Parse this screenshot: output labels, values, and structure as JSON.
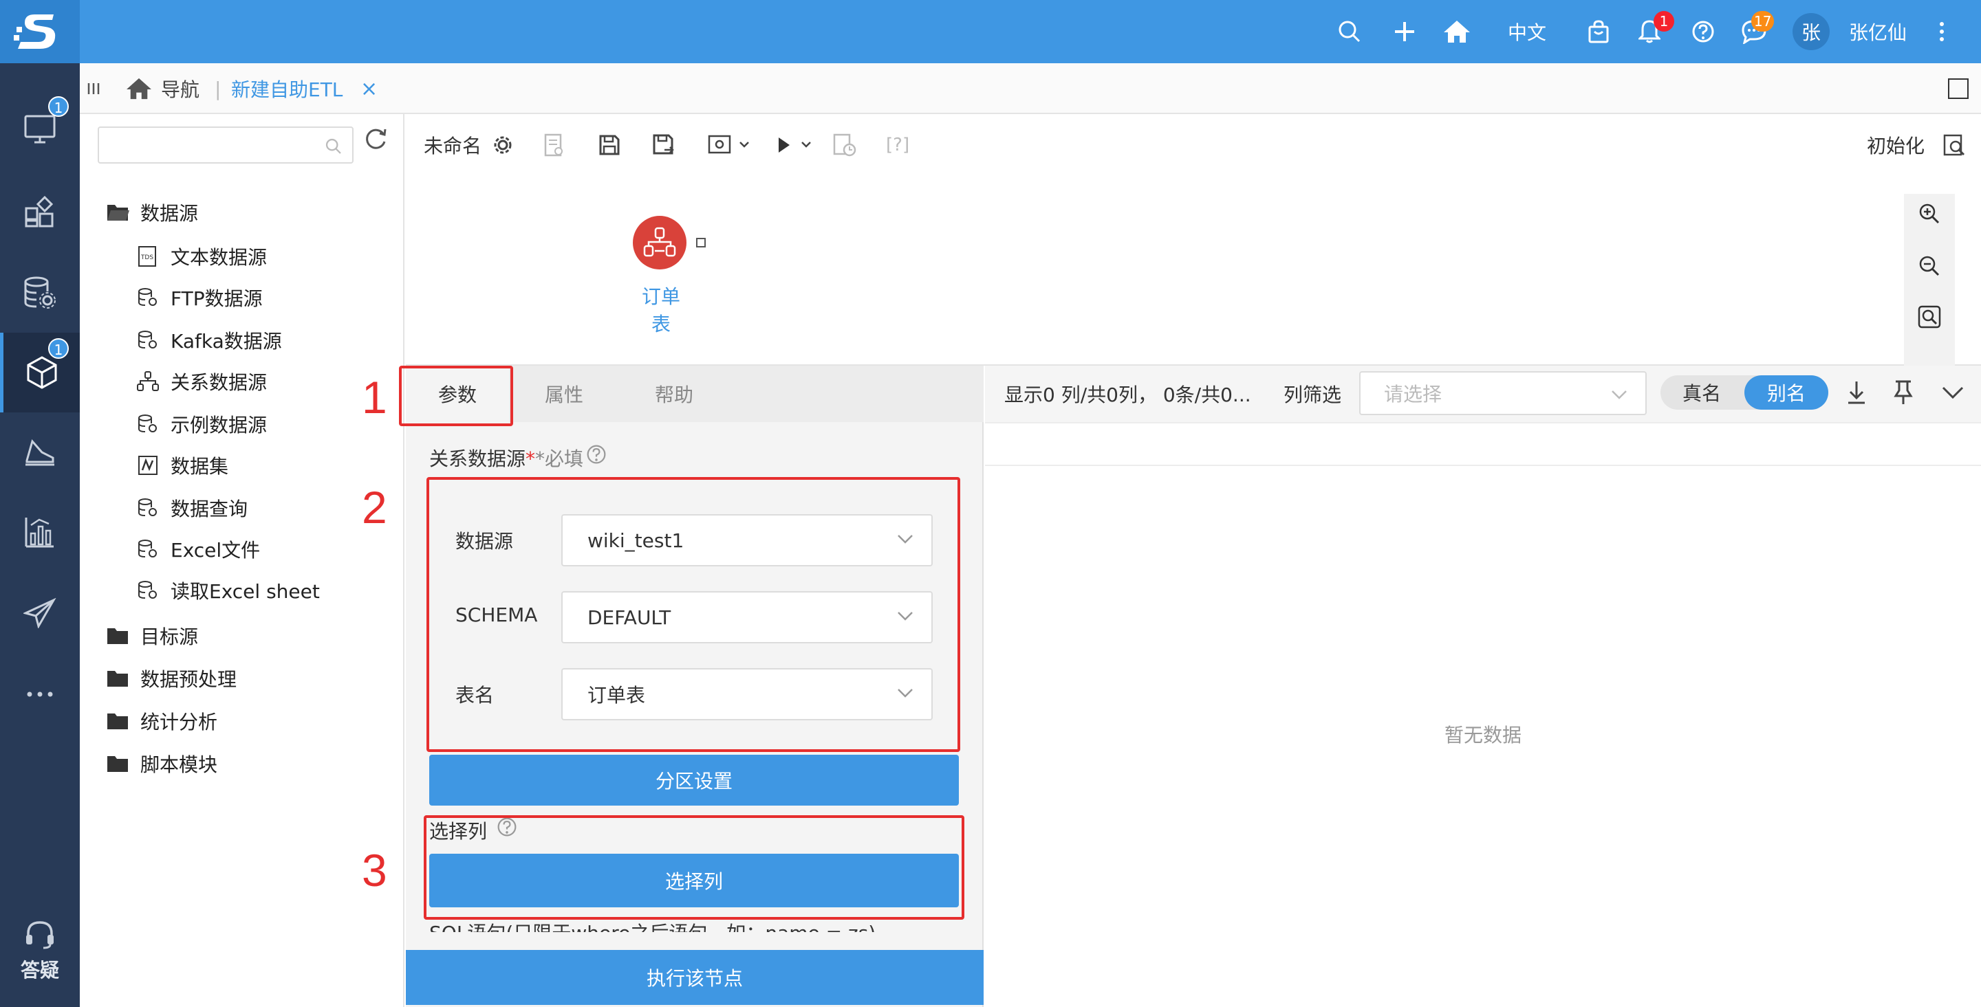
{
  "topbar": {
    "language": "中文",
    "notification_badge": "1",
    "message_badge": "17",
    "avatar_initial": "张",
    "username": "张亿仙"
  },
  "leftnav": {
    "badge_1": "1",
    "badge_2": "1",
    "help_label": "答疑"
  },
  "tabrow": {
    "nav_label": "导航",
    "active_tab": "新建自助ETL",
    "close": "×"
  },
  "sidebar": {
    "search_placeholder": "",
    "items": [
      {
        "label": "数据源",
        "type": "folder-open"
      },
      {
        "label": "文本数据源",
        "type": "tds"
      },
      {
        "label": "FTP数据源",
        "type": "db"
      },
      {
        "label": "Kafka数据源",
        "type": "db"
      },
      {
        "label": "关系数据源",
        "type": "relation"
      },
      {
        "label": "示例数据源",
        "type": "db"
      },
      {
        "label": "数据集",
        "type": "dataset"
      },
      {
        "label": "数据查询",
        "type": "db"
      },
      {
        "label": "Excel文件",
        "type": "db"
      },
      {
        "label": "读取Excel sheet",
        "type": "db"
      },
      {
        "label": "目标源",
        "type": "folder"
      },
      {
        "label": "数据预处理",
        "type": "folder"
      },
      {
        "label": "统计分析",
        "type": "folder"
      },
      {
        "label": "脚本模块",
        "type": "folder"
      }
    ]
  },
  "canvas": {
    "title": "未命名",
    "help_bracket": "[?]",
    "init_label": "初始化",
    "node_label": "订单表"
  },
  "params": {
    "tabs": [
      "参数",
      "属性",
      "帮助"
    ],
    "section_label": "关系数据源",
    "required_label": "*必填",
    "datasource_label": "数据源",
    "datasource_value": "wiki_test1",
    "schema_label": "SCHEMA",
    "schema_value": "DEFAULT",
    "table_label": "表名",
    "table_value": "订单表",
    "partition_button": "分区设置",
    "select_col_label": "选择列",
    "select_col_button": "选择列",
    "sql_label": "SQL语句(只限于where之后语句，如：name = zs)",
    "execute_button": "执行该节点",
    "annotations": [
      "1",
      "2",
      "3"
    ]
  },
  "result": {
    "summary": "显示0 列/共0列，  0条/共0...",
    "filter_label": "列筛选",
    "filter_placeholder": "请选择",
    "toggle_real": "真名",
    "toggle_alias": "别名",
    "empty_text": "暂无数据"
  },
  "colors": {
    "primary": "#3f97e3",
    "nav_bg": "#283a57",
    "annotation_red": "#e62e2e",
    "node_red": "#d9423a"
  }
}
